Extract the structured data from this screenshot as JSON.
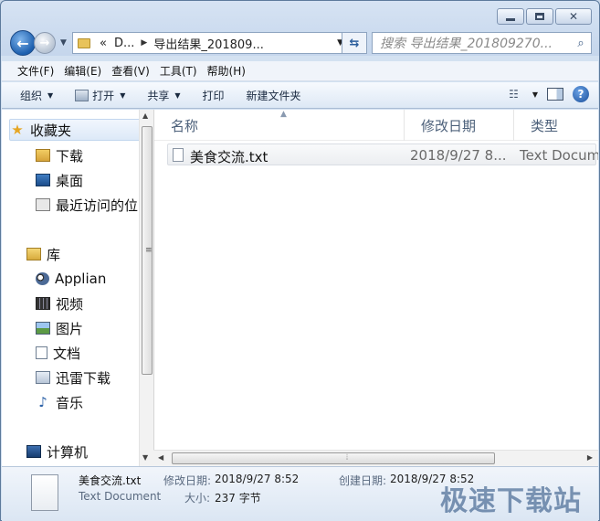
{
  "window": {
    "address": {
      "segments": [
        "D...",
        "导出结果_201809..."
      ],
      "prefix": "«"
    },
    "search": {
      "placeholder": "搜索 导出结果_201809270..."
    }
  },
  "menubar": [
    "文件(F)",
    "编辑(E)",
    "查看(V)",
    "工具(T)",
    "帮助(H)"
  ],
  "toolbar": {
    "organize": "组织",
    "open": "打开",
    "share": "共享",
    "print": "打印",
    "new_folder": "新建文件夹"
  },
  "nav": {
    "favorites": "收藏夹",
    "downloads": "下载",
    "desktop": "桌面",
    "recent": "最近访问的位",
    "libraries": "库",
    "applian": "Applian",
    "videos": "视频",
    "pictures": "图片",
    "documents": "文档",
    "xunlei": "迅雷下载",
    "music": "音乐",
    "computer": "计算机"
  },
  "columns": {
    "name": "名称",
    "date": "修改日期",
    "type": "类型"
  },
  "files": [
    {
      "name": "美食交流.txt",
      "date": "2018/9/27 8...",
      "type": "Text Docum"
    }
  ],
  "details": {
    "filename": "美食交流.txt",
    "filetype": "Text Document",
    "modified_label": "修改日期:",
    "modified": "2018/9/27 8:52",
    "created_label": "创建日期:",
    "created": "2018/9/27 8:52",
    "size_label": "大小:",
    "size": "237 字节"
  },
  "watermark": "极速下载站"
}
